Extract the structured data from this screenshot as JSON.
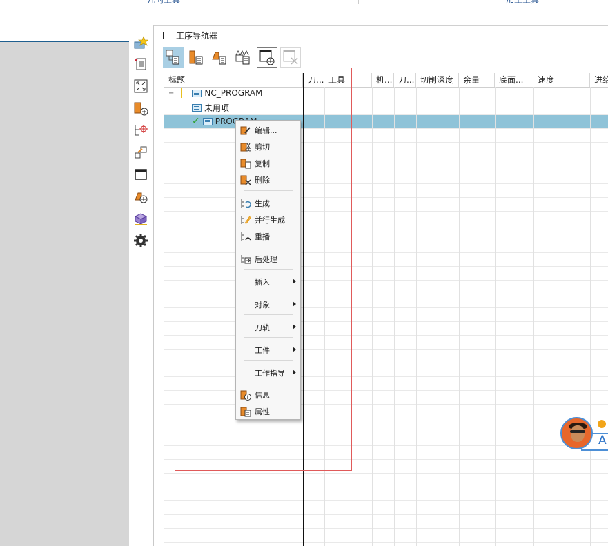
{
  "ribbon": {
    "tab_left": "几何工具",
    "tab_right": "加工工具"
  },
  "navigator": {
    "title": "工序导航器"
  },
  "columns": [
    "标题",
    "刀...",
    "工具",
    "机...",
    "刀...",
    "切削深度",
    "余量",
    "底面...",
    "速度",
    "进给"
  ],
  "tree": {
    "root": "NC_PROGRAM",
    "unused": "未用项",
    "program": "PROGRAM"
  },
  "context_menu": {
    "items": [
      {
        "label": "编辑...",
        "icon": "edit-icon",
        "submenu": false
      },
      {
        "label": "剪切",
        "icon": "cut-icon",
        "submenu": false
      },
      {
        "label": "复制",
        "icon": "copy-icon",
        "submenu": false
      },
      {
        "label": "删除",
        "icon": "delete-icon",
        "submenu": false
      },
      {
        "label": "生成",
        "icon": "generate-icon",
        "submenu": false
      },
      {
        "label": "并行生成",
        "icon": "parallel-generate-icon",
        "submenu": false
      },
      {
        "label": "重播",
        "icon": "replay-icon",
        "submenu": false
      },
      {
        "label": "后处理",
        "icon": "postprocess-icon",
        "submenu": false
      },
      {
        "label": "插入",
        "icon": "",
        "submenu": true
      },
      {
        "label": "对象",
        "icon": "",
        "submenu": true
      },
      {
        "label": "刀轨",
        "icon": "",
        "submenu": true
      },
      {
        "label": "工件",
        "icon": "",
        "submenu": true
      },
      {
        "label": "工作指导",
        "icon": "",
        "submenu": true
      },
      {
        "label": "信息",
        "icon": "info-icon",
        "submenu": false
      },
      {
        "label": "属性",
        "icon": "properties-icon",
        "submenu": false
      }
    ]
  },
  "widget": {
    "letter": "A"
  },
  "colors": {
    "selection": "#8fc3d8",
    "highlight_box": "#e05a5a",
    "accent": "#1f5f8f"
  }
}
